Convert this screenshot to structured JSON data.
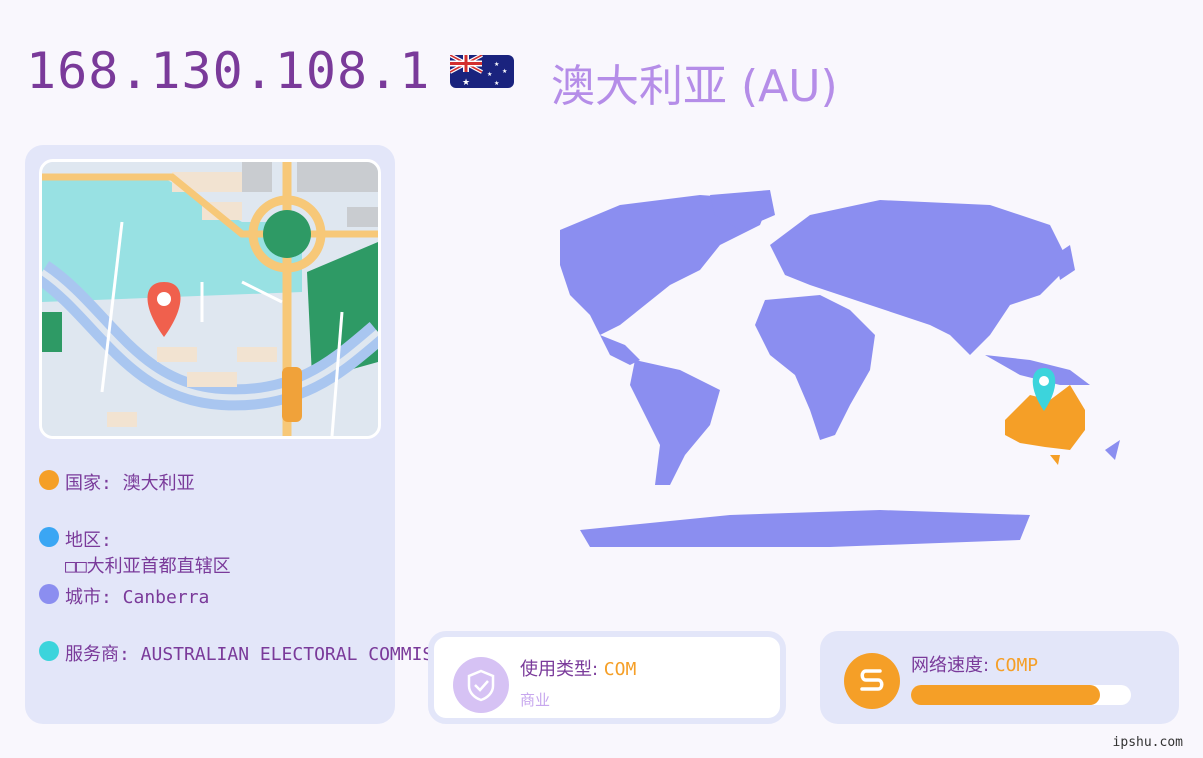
{
  "header": {
    "ip": "168.130.108.1",
    "country_title": "澳大利亚 (AU)",
    "flag_icon": "australia-flag-icon"
  },
  "info": {
    "country": "国家: 澳大利亚",
    "region_label": "地区:",
    "region_value": "□□大利亚首都直辖区",
    "city": "城市: Canberra",
    "isp": "服务商: AUSTRALIAN ELECTORAL COMMISSION",
    "colors": {
      "country": "#f59f27",
      "region": "#3aa6f4",
      "city": "#8b8ef0",
      "isp": "#3cd4dc"
    }
  },
  "usage": {
    "label": "使用类型: ",
    "value": "COM",
    "sub": "商业",
    "icon": "shield-check-icon"
  },
  "speed": {
    "label": "网络速度: ",
    "value": "COMP",
    "icon": "speed-s-icon",
    "progress": 0.86
  },
  "footer": {
    "site": "ipshu.com"
  },
  "colors": {
    "accent": "#f59f27",
    "title": "#7a3a9a",
    "country": "#b58de8",
    "panel": "#e3e6f9",
    "map": "#8b8ef0"
  }
}
